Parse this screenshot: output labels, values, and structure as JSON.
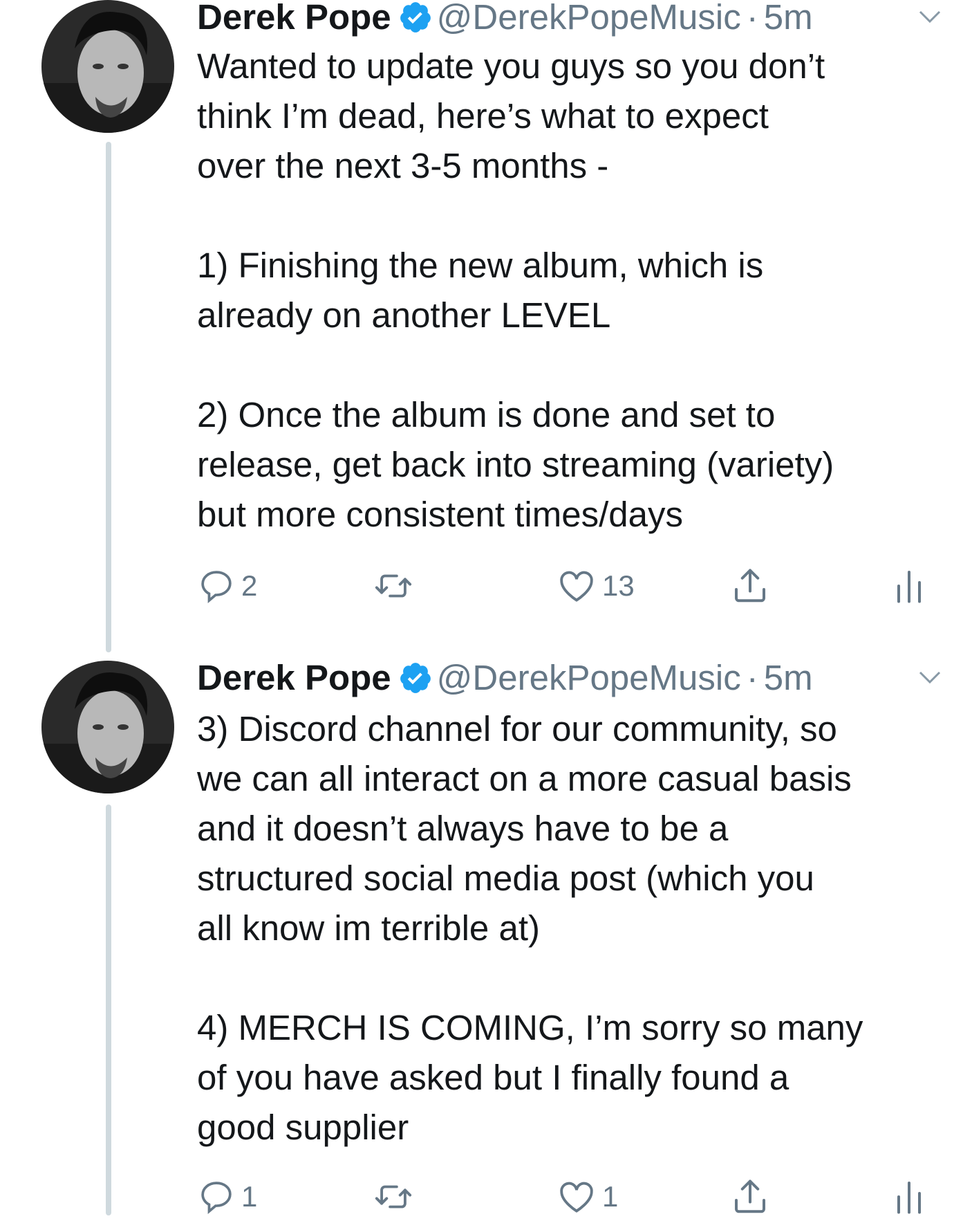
{
  "colors": {
    "verified": "#1da1f2",
    "muted": "#657786",
    "thread_line": "#cfd9de",
    "text": "#14171a"
  },
  "tweets": [
    {
      "author_name": "Derek Pope",
      "handle": "@DerekPopeMusic",
      "separator": "·",
      "time": "5m",
      "verified": true,
      "text": "Wanted to update you guys so you don’t\nthink I’m dead, here’s what to expect\nover the next 3-5 months -\n\n1) Finishing the new album, which is\nalready on another LEVEL\n\n2) Once the album is done and set to\nrelease, get back into streaming (variety)\nbut more consistent times/days",
      "replies": "2",
      "retweets": "",
      "likes": "13"
    },
    {
      "author_name": "Derek Pope",
      "handle": "@DerekPopeMusic",
      "separator": "·",
      "time": "5m",
      "verified": true,
      "text": "3) Discord channel for our community, so\nwe can all interact on a more casual basis\nand it doesn’t always have to be a\nstructured social media post (which you\nall know im terrible at)\n\n4) MERCH IS COMING, I’m sorry so many\nof you have asked but I finally found a\ngood supplier",
      "replies": "1",
      "retweets": "",
      "likes": "1"
    }
  ],
  "icons": {
    "reply": "reply-icon",
    "retweet": "retweet-icon",
    "like": "heart-icon",
    "share": "share-icon",
    "analytics": "analytics-icon",
    "verified": "verified-badge-icon",
    "more": "chevron-down-icon"
  }
}
